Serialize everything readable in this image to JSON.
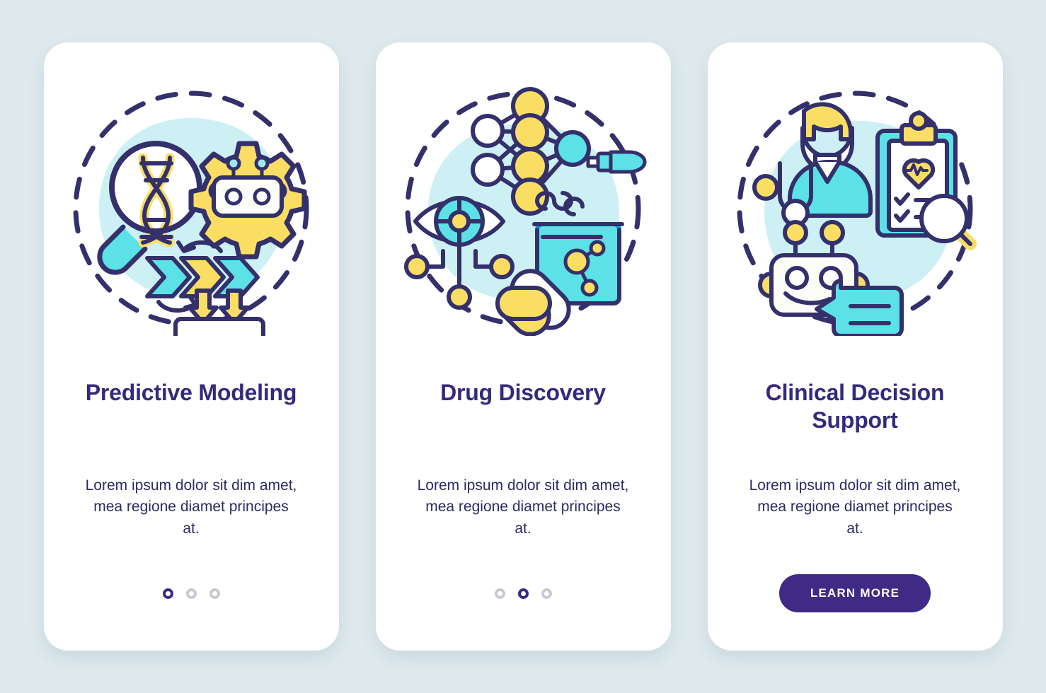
{
  "theme": {
    "page_background": "#dfeaee",
    "card_background": "#ffffff",
    "title_color": "#332a7c",
    "body_text_color": "#2c2b63",
    "accent_purple": "#3f2a85",
    "accent_cyan": "#5ce1e6",
    "accent_cyan_light": "#cdf0f5",
    "accent_yellow": "#fade64",
    "outline_color": "#33306b",
    "dot_inactive_color": "#c9c9d4"
  },
  "screens": [
    {
      "illustration": "predictive-modeling-illustration",
      "title": "Predictive Modeling",
      "description": "Lorem ipsum dolor sit dim amet, mea regione diamet principes at.",
      "footer_type": "dots",
      "dots": {
        "count": 3,
        "active_index": 0
      }
    },
    {
      "illustration": "drug-discovery-illustration",
      "title": "Drug Discovery",
      "description": "Lorem ipsum dolor sit dim amet, mea regione diamet principes at.",
      "footer_type": "dots",
      "dots": {
        "count": 3,
        "active_index": 1
      }
    },
    {
      "illustration": "clinical-decision-support-illustration",
      "title": "Clinical Decision Support",
      "description": "Lorem ipsum dolor sit dim amet, mea regione diamet principes at.",
      "footer_type": "button",
      "button_label": "LEARN MORE"
    }
  ]
}
